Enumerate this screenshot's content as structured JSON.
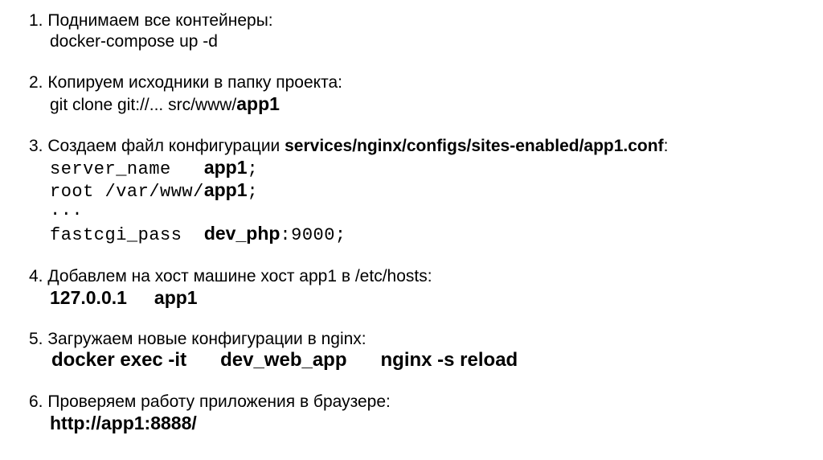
{
  "steps": [
    {
      "num": "1.",
      "title": "Поднимаем все контейнеры:",
      "command": "docker-compose up -d"
    },
    {
      "num": "2.",
      "title": "Копируем исходники в папку проекта:",
      "command_prefix": "git clone git://... src/www/",
      "command_bold": "app1"
    },
    {
      "num": "3.",
      "title": "Создаем файл конфигурации ",
      "title_bold": "services/nginx/configs/sites-enabled/app1.conf",
      "title_suffix": ":",
      "config": {
        "server_name_key": "server_name   ",
        "server_name_val": "app1",
        "server_name_end": ";",
        "root_key": "root /var/www/",
        "root_val": "app1",
        "root_end": ";",
        "ellipsis": "...",
        "fastcgi_key": "fastcgi_pass  ",
        "fastcgi_val": "dev_php",
        "fastcgi_end": ":9000;"
      }
    },
    {
      "num": "4.",
      "title": "Добавлем на хост машине хост app1 в /etc/hosts:",
      "ip": "127.0.0.1",
      "host": "app1"
    },
    {
      "num": "5.",
      "title": "Загружаем новые конфигурации в nginx:",
      "cmd1": "docker exec -it",
      "cmd2": "dev_web_app",
      "cmd3": "nginx -s reload"
    },
    {
      "num": "6.",
      "title": "Проверяем работу приложения в браузере:",
      "url": "http://app1:8888/"
    }
  ]
}
